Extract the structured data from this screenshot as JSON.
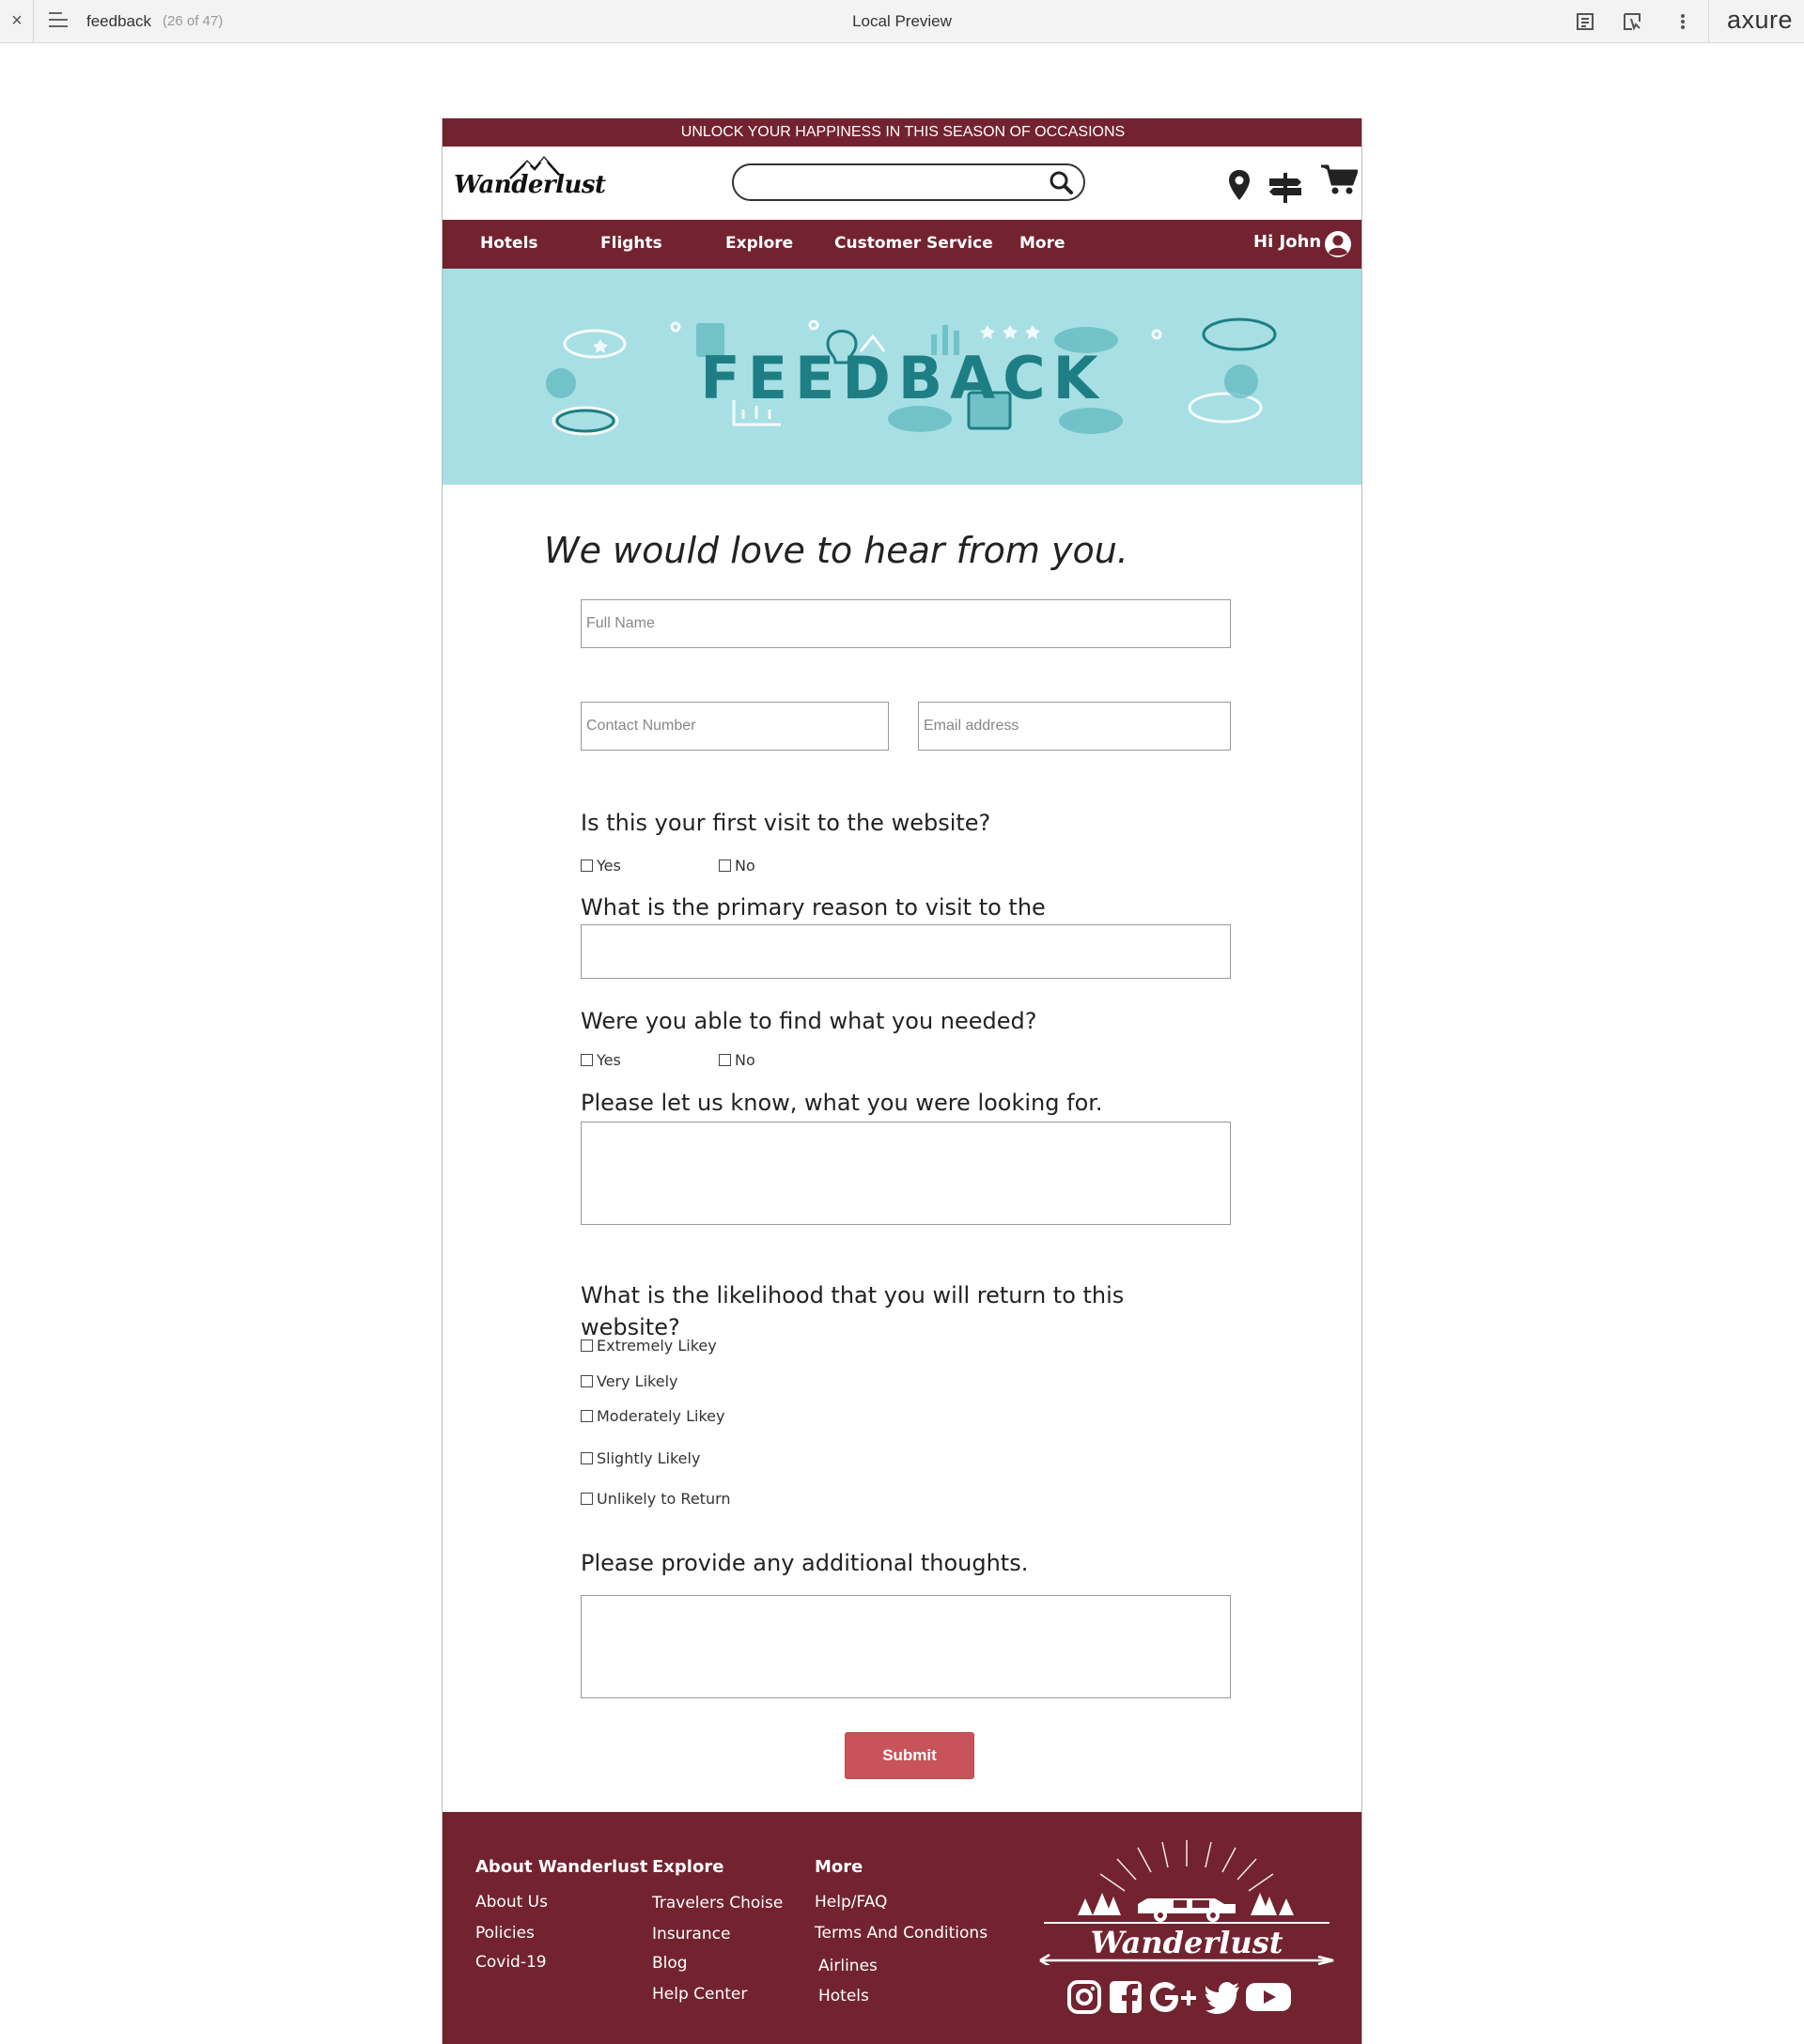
{
  "preview_bar": {
    "page_name": "feedback",
    "page_count": "(26 of 47)",
    "title": "Local Preview",
    "brand": "axure"
  },
  "promo": "UNLOCK YOUR HAPPINESS IN THIS SEASON OF OCCASIONS",
  "logo_text": "Wanderlust",
  "nav": {
    "items": [
      "Hotels",
      "Flights",
      "Explore",
      "Customer Service",
      "More"
    ],
    "greeting": "Hi John"
  },
  "banner_text": "FEEDBACK",
  "form": {
    "heading": "We would love to hear from you.",
    "full_name_placeholder": "Full Name",
    "contact_placeholder": "Contact Number",
    "email_placeholder": "Email address",
    "q_first_visit": "Is this your first visit to the website?",
    "q_reason": "What is the primary reason to visit to the",
    "q_found": "Were you able to find what you needed?",
    "q_looking": "Please let us know, what you were looking for.",
    "q_likelihood_line1": "What is the likelihood that you will return to this",
    "q_likelihood_line2": "website?",
    "q_thoughts": "Please provide any additional thoughts.",
    "yes": "Yes",
    "no": "No",
    "likelihood_options": [
      "Extremely Likey",
      "Very Likely",
      "Moderately Likey",
      "Slightly Likely",
      "Unlikely to Return"
    ],
    "submit": "Submit"
  },
  "footer": {
    "col1": {
      "heading": "About Wanderlust",
      "links": [
        "About Us",
        "Policies",
        "Covid-19"
      ]
    },
    "col2": {
      "heading": "Explore",
      "links": [
        "Travelers Choise",
        "Insurance",
        "Blog",
        "Help Center"
      ]
    },
    "col3": {
      "heading": "More",
      "links": [
        "Help/FAQ",
        "Terms And Conditions",
        "Airlines",
        "Hotels"
      ]
    },
    "logo_text": "Wanderlust"
  },
  "colors": {
    "brand_maroon": "#72232f",
    "banner_teal": "#a7dfe4",
    "banner_text": "#1d7e83",
    "submit_red": "#c85459"
  }
}
